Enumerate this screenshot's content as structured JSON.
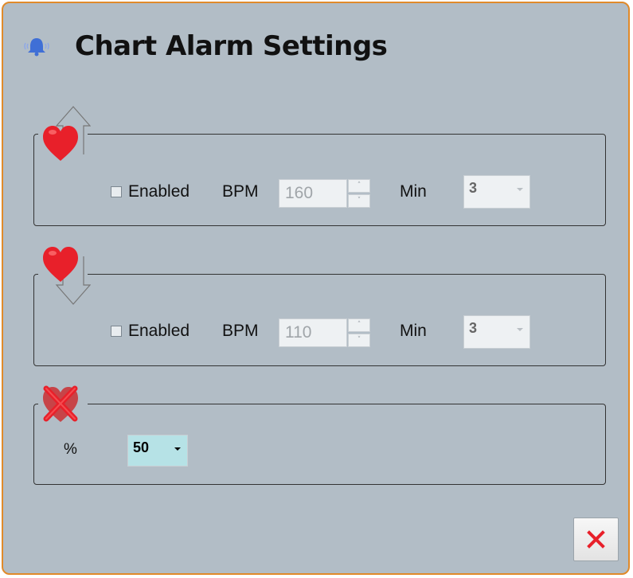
{
  "dialog": {
    "title": "Chart Alarm Settings",
    "accent_color": "#e08a2a",
    "background_color": "#b2bdc6"
  },
  "high_alarm": {
    "icon": "heart-arrow-up-icon",
    "enabled_label": "Enabled",
    "enabled": false,
    "bpm_label": "BPM",
    "bpm_value": "160",
    "min_label": "Min",
    "min_value": "3"
  },
  "low_alarm": {
    "icon": "heart-arrow-down-icon",
    "enabled_label": "Enabled",
    "enabled": false,
    "bpm_label": "BPM",
    "bpm_value": "110",
    "min_label": "Min",
    "min_value": "3"
  },
  "signal_loss": {
    "icon": "heart-crossed-icon",
    "percent_label": "%",
    "percent_value": "50"
  },
  "footer": {
    "close_icon": "close-icon",
    "close_color": "#e8202a"
  },
  "icons": {
    "bell": "bell-icon",
    "spin_up": "˄",
    "spin_down": "˅"
  }
}
